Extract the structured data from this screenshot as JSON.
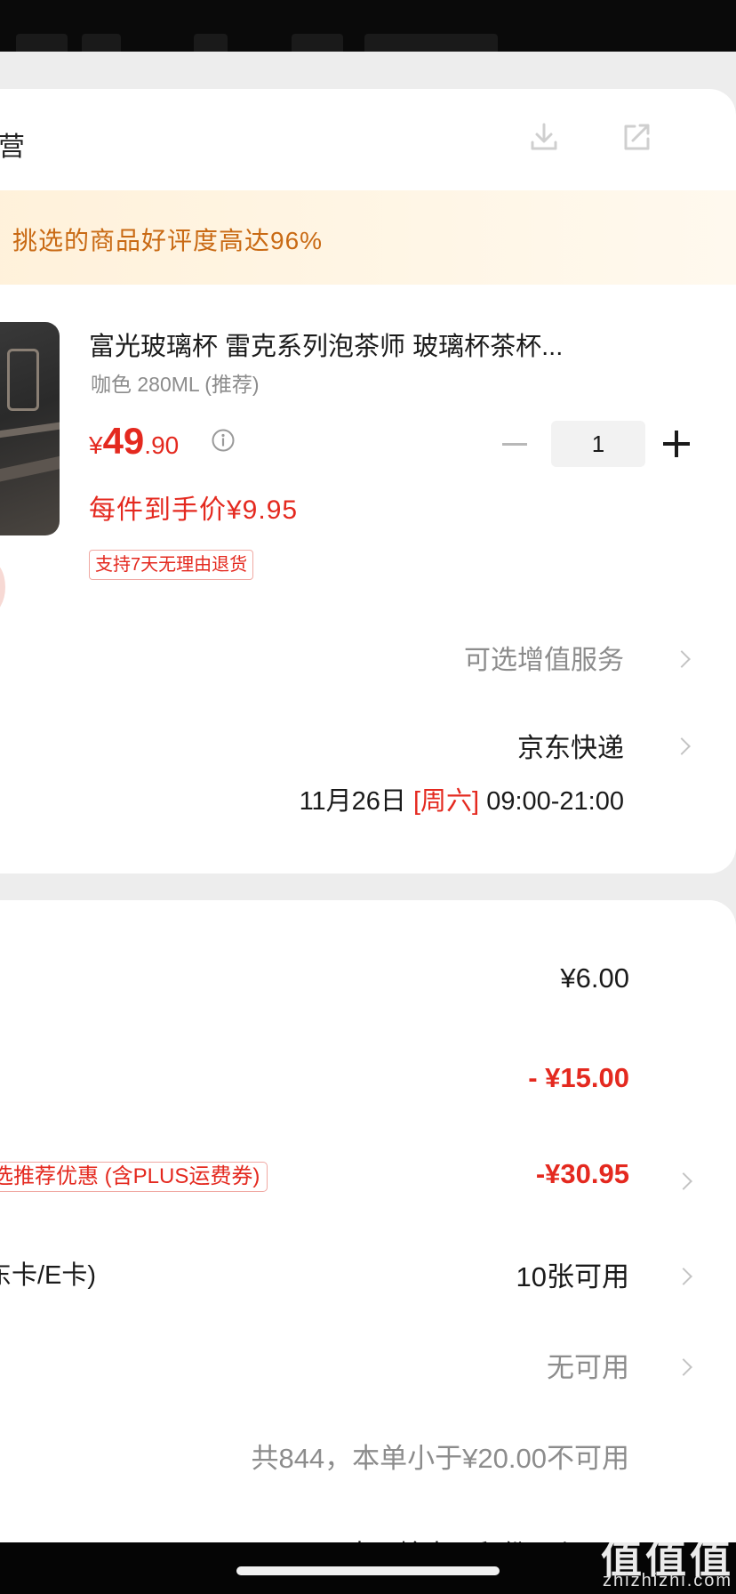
{
  "header": {
    "title_fragment": "营"
  },
  "banner": {
    "text": "挑选的商品好评度高达96%"
  },
  "product": {
    "title": "富光玻璃杯 雷克系列泡茶师 玻璃杯茶杯...",
    "variant": "咖色 280ML (推荐)",
    "price_symbol": "¥",
    "price_int": "49",
    "price_dec": ".90",
    "quantity": "1",
    "unit_price": "每件到手价¥9.95",
    "return_tag": "支持7天无理由退货"
  },
  "services": {
    "vas_label": "可选增值服务"
  },
  "shipping": {
    "carrier": "京东快递",
    "date": "11月26日",
    "weekday": "[周六]",
    "time": "09:00-21:00"
  },
  "summary": {
    "row1_value": "¥6.00",
    "row2_value": "- ¥15.00",
    "row3_label": "选推荐优惠 (含PLUS运费券)",
    "row3_value": "-¥30.95",
    "row4_label": "东卡/E卡)",
    "row4_value": "10张可用",
    "row5_value": "无可用",
    "row6_value": "共844，本单小于¥20.00不可用",
    "row7_fragment": "去开始支用积份一么"
  },
  "watermark": {
    "chars": "值值值",
    "url": "zhizhizhi.com"
  },
  "colors": {
    "accent_red": "#e4291f",
    "banner_orange": "#c96a14",
    "muted_gray": "#8c8c8c"
  }
}
